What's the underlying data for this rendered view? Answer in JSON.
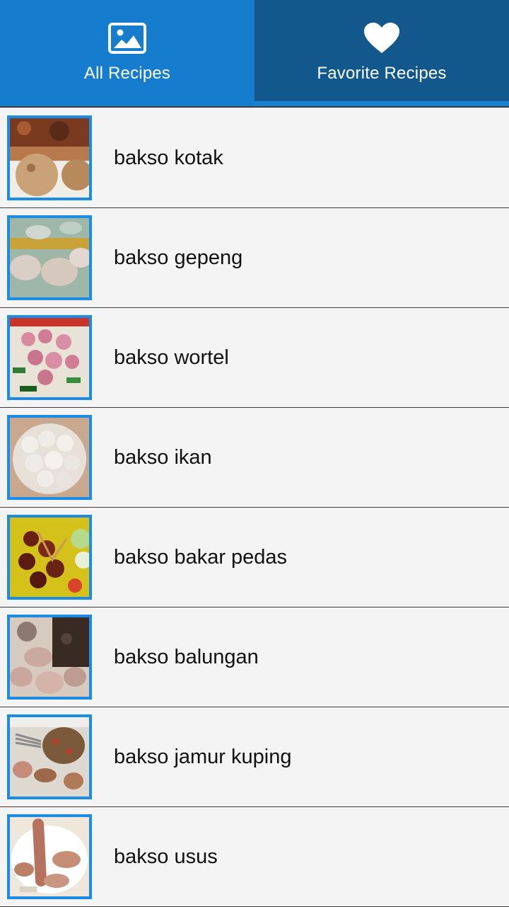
{
  "tabs": [
    {
      "label": "All Recipes",
      "icon": "image-icon",
      "active": true
    },
    {
      "label": "Favorite Recipes",
      "icon": "heart-icon",
      "active": false
    }
  ],
  "recipes": [
    {
      "name": "bakso kotak"
    },
    {
      "name": "bakso gepeng"
    },
    {
      "name": "bakso wortel"
    },
    {
      "name": "bakso ikan"
    },
    {
      "name": "bakso bakar pedas"
    },
    {
      "name": "bakso balungan"
    },
    {
      "name": "bakso jamur kuping"
    },
    {
      "name": "bakso usus"
    }
  ],
  "colors": {
    "tab_active": "#157cce",
    "tab_inactive": "#12588d",
    "thumb_border": "#1c8be3",
    "list_bg": "#f4f4f4"
  }
}
